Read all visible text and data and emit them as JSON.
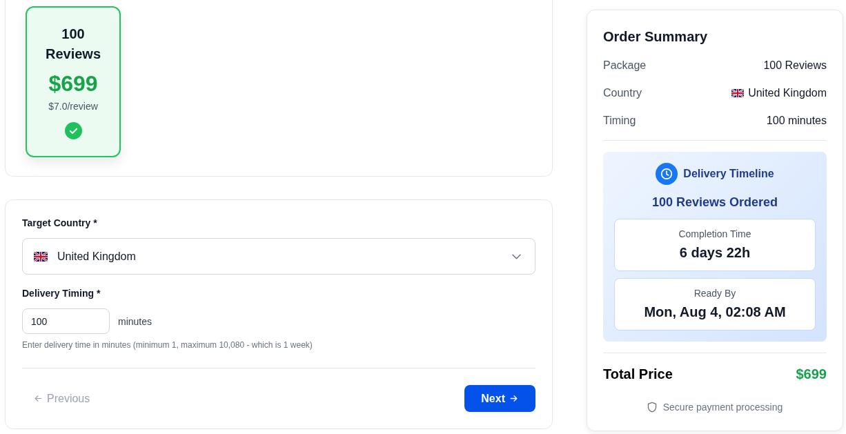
{
  "package_options": [
    {
      "title": "100 Reviews",
      "price": "$699",
      "unit_price": "$7.0/review",
      "selected": true
    }
  ],
  "form": {
    "country": {
      "label": "Target Country *",
      "value": "United Kingdom"
    },
    "timing": {
      "label": "Delivery Timing *",
      "value": "100",
      "unit": "minutes",
      "help": "Enter delivery time in minutes (minimum 1, maximum 10,080 - which is 1 week)"
    },
    "buttons": [
      {
        "label": "Previous",
        "kind": "back",
        "disabled": true
      },
      {
        "label": "Next",
        "kind": "next",
        "disabled": false
      }
    ]
  },
  "order_summary": {
    "title": "Order Summary",
    "rows": [
      {
        "label": "Package",
        "value": "100 Reviews",
        "kind": "text"
      },
      {
        "label": "Country",
        "value": "United Kingdom",
        "kind": "flag"
      },
      {
        "label": "Timing",
        "value": "100 minutes",
        "kind": "text"
      }
    ],
    "timeline": {
      "title": "Delivery Timeline",
      "subtitle": "100 Reviews Ordered",
      "boxes": [
        {
          "label": "Completion Time",
          "value": "6 days 22h"
        },
        {
          "label": "Ready By",
          "value": "Mon, Aug 4, 02:08 AM"
        }
      ]
    },
    "total": {
      "label": "Total Price",
      "value": "$699"
    },
    "note": "Secure payment processing"
  }
}
